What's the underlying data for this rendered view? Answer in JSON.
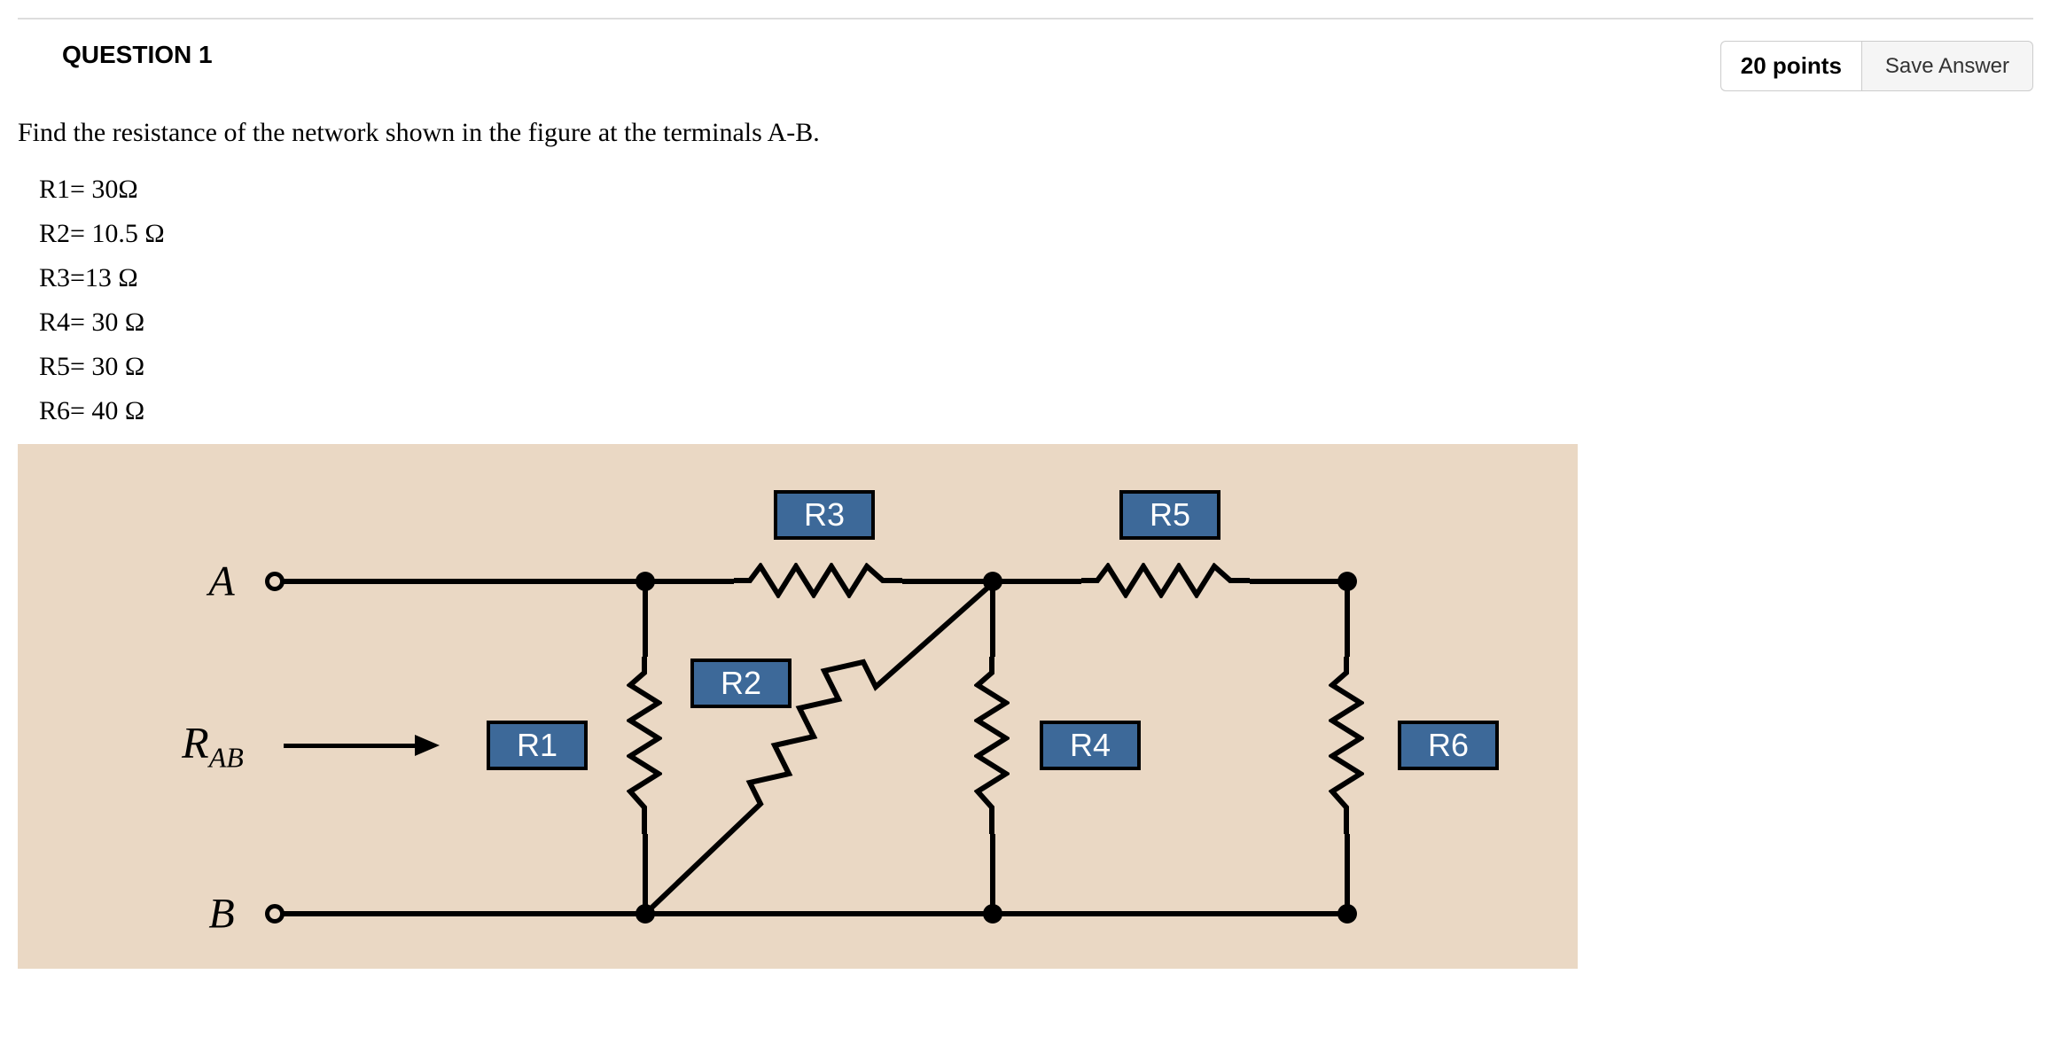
{
  "question": {
    "title": "QUESTION 1",
    "points": "20 points",
    "save_label": "Save Answer",
    "prompt": "Find the resistance of the network shown in the figure at the terminals A-B.",
    "values": {
      "r1": "R1= 30Ω",
      "r2": "R2= 10.5 Ω",
      "r3": "R3=13 Ω",
      "r4": "R4= 30 Ω",
      "r5": "R5= 30 Ω",
      "r6": "R6= 40 Ω"
    }
  },
  "figure": {
    "labels": {
      "A": "A",
      "B": "B",
      "RAB": "R",
      "RAB_sub": "AB",
      "R1": "R1",
      "R2": "R2",
      "R3": "R3",
      "R4": "R4",
      "R5": "R5",
      "R6": "R6"
    }
  }
}
